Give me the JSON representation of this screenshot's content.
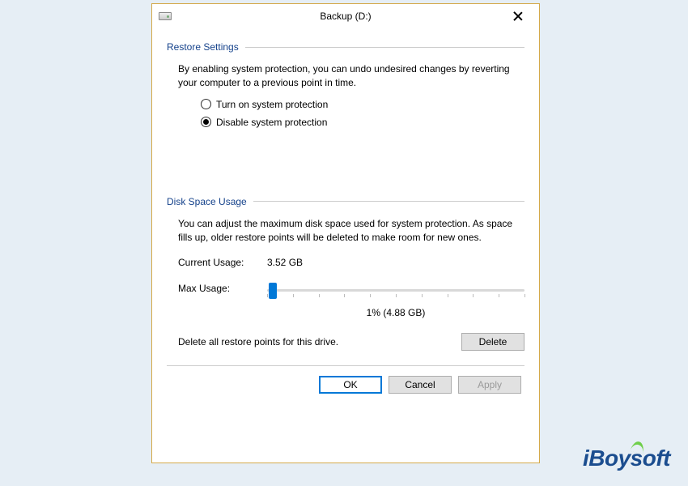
{
  "titlebar": {
    "title": "Backup (D:)"
  },
  "restore": {
    "heading": "Restore Settings",
    "description": "By enabling system protection, you can undo undesired changes by reverting your computer to a previous point in time.",
    "option_on": "Turn on system protection",
    "option_off": "Disable system protection",
    "selected": "off"
  },
  "disk": {
    "heading": "Disk Space Usage",
    "description": "You can adjust the maximum disk space used for system protection. As space fills up, older restore points will be deleted to make room for new ones.",
    "current_label": "Current Usage:",
    "current_value": "3.52 GB",
    "max_label": "Max Usage:",
    "slider_value": "1% (4.88 GB)",
    "delete_text": "Delete all restore points for this drive.",
    "delete_btn": "Delete"
  },
  "buttons": {
    "ok": "OK",
    "cancel": "Cancel",
    "apply": "Apply"
  },
  "watermark": "iBoysoft"
}
